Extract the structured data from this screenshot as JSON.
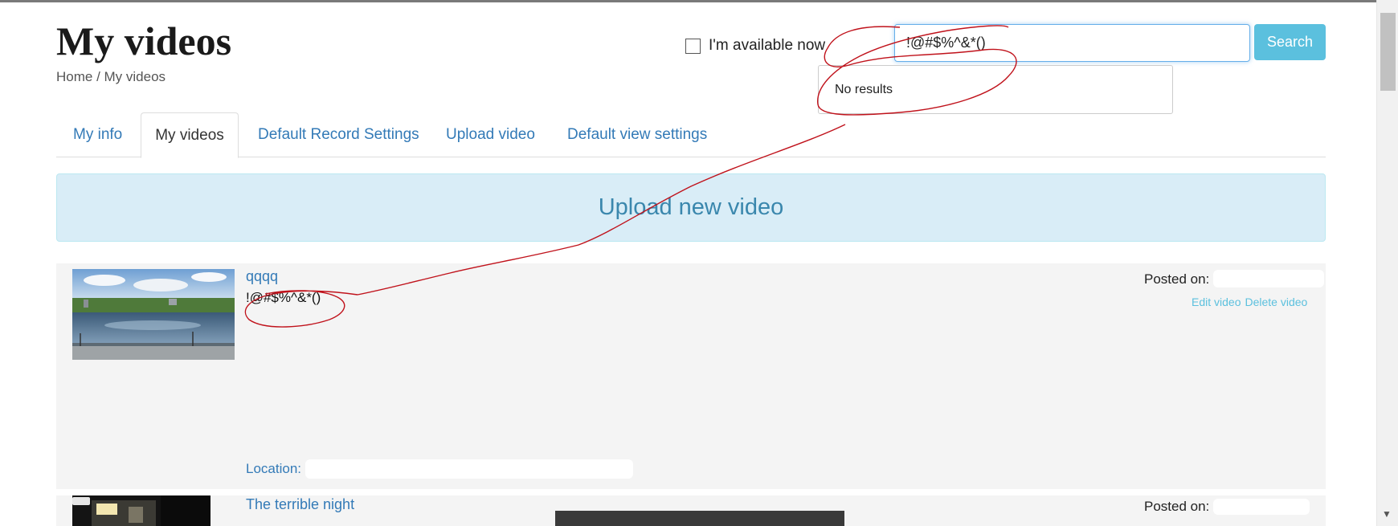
{
  "header": {
    "title": "My videos",
    "breadcrumb": "Home / My videos",
    "availability_label": "I'm available now"
  },
  "search": {
    "query": "!@#$%^&*()",
    "button_label": "Search",
    "dropdown_text": "No results"
  },
  "tabs": [
    {
      "label": "My info",
      "active": false
    },
    {
      "label": "My videos",
      "active": true
    },
    {
      "label": "Default Record Settings",
      "active": false
    },
    {
      "label": "Upload video",
      "active": false
    },
    {
      "label": "Default view settings",
      "active": false
    }
  ],
  "upload_banner": "Upload new video",
  "videos": [
    {
      "title": "qqqq",
      "description": "!@#$%^&*()",
      "posted_label": "Posted on:",
      "edit_label": "Edit video",
      "delete_label": "Delete video",
      "location_label": "Location:"
    },
    {
      "title": "The terrible night",
      "posted_label": "Posted on:"
    }
  ],
  "colors": {
    "link": "#337ab7",
    "search_button": "#5bc0de",
    "banner_bg": "#d9edf7",
    "annotation": "#c0121b"
  }
}
